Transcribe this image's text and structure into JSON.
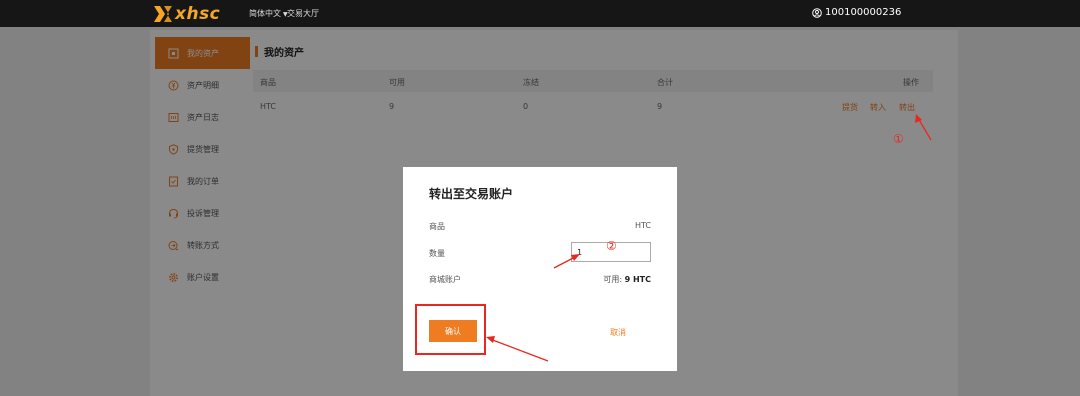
{
  "topbar": {
    "logo_text": "xhsc",
    "language": "简体中文",
    "trading_hall": "交易大厅",
    "account": "100100000236"
  },
  "sidebar": {
    "items": [
      {
        "label": "我的资产",
        "icon": "wallet-icon"
      },
      {
        "label": "资产明细",
        "icon": "coin-icon"
      },
      {
        "label": "资产日志",
        "icon": "log-icon"
      },
      {
        "label": "提货管理",
        "icon": "shield-icon"
      },
      {
        "label": "我的订单",
        "icon": "order-icon"
      },
      {
        "label": "投诉管理",
        "icon": "headset-icon"
      },
      {
        "label": "转账方式",
        "icon": "transfer-icon"
      },
      {
        "label": "账户设置",
        "icon": "gear-icon"
      }
    ]
  },
  "assets": {
    "title": "我的资产",
    "columns": [
      "商品",
      "可用",
      "冻结",
      "合计",
      "操作"
    ],
    "rows": [
      {
        "product": "HTC",
        "available": "9",
        "frozen": "0",
        "total": "9",
        "actions": [
          "提货",
          "转入",
          "转出"
        ]
      }
    ]
  },
  "modal": {
    "title": "转出至交易账户",
    "product_label": "商品",
    "product_value": "HTC",
    "quantity_label": "数量",
    "quantity_value": "1",
    "account_label": "商城账户",
    "available_prefix": "可用:",
    "available_value": "9 HTC",
    "confirm_label": "确认",
    "cancel_label": "取消"
  },
  "annotations": {
    "marker_1": "①",
    "marker_2": "②",
    "color": "#e8281e"
  },
  "colors": {
    "accent": "#f07c22",
    "topbar": "#161616"
  }
}
